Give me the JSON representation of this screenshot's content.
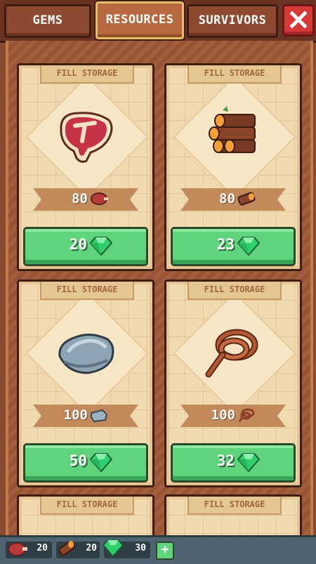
{
  "tabs": [
    {
      "label": "GEMS",
      "active": false
    },
    {
      "label": "RESOURCES",
      "active": true
    },
    {
      "label": "SURVIVORS",
      "active": false
    }
  ],
  "close_icon": "close-x-icon",
  "cards": [
    {
      "label": "FILL STORAGE",
      "resource_icon": "steak-icon",
      "amount": "80",
      "amount_icon": "meat-icon",
      "price": "20",
      "price_icon": "gem-icon"
    },
    {
      "label": "FILL STORAGE",
      "resource_icon": "logs-icon",
      "amount": "80",
      "amount_icon": "log-icon",
      "price": "23",
      "price_icon": "gem-icon"
    },
    {
      "label": "FILL STORAGE",
      "resource_icon": "stone-icon",
      "amount": "100",
      "amount_icon": "stone-bar-icon",
      "price": "50",
      "price_icon": "gem-icon"
    },
    {
      "label": "FILL STORAGE",
      "resource_icon": "rope-icon",
      "amount": "100",
      "amount_icon": "rope-small-icon",
      "price": "32",
      "price_icon": "gem-icon"
    },
    {
      "label": "FILL STORAGE"
    },
    {
      "label": "FILL STORAGE"
    }
  ],
  "bottom_bar": {
    "meat_count": "20",
    "wood_count": "20",
    "gem_count": "30",
    "plus_label": "+"
  },
  "colors": {
    "button_green": "#5fd47c",
    "gem_green": "#2fd06a",
    "close_red": "#d63a38",
    "card_bg": "#f1d9b0",
    "panel_brown": "#9c5636"
  }
}
